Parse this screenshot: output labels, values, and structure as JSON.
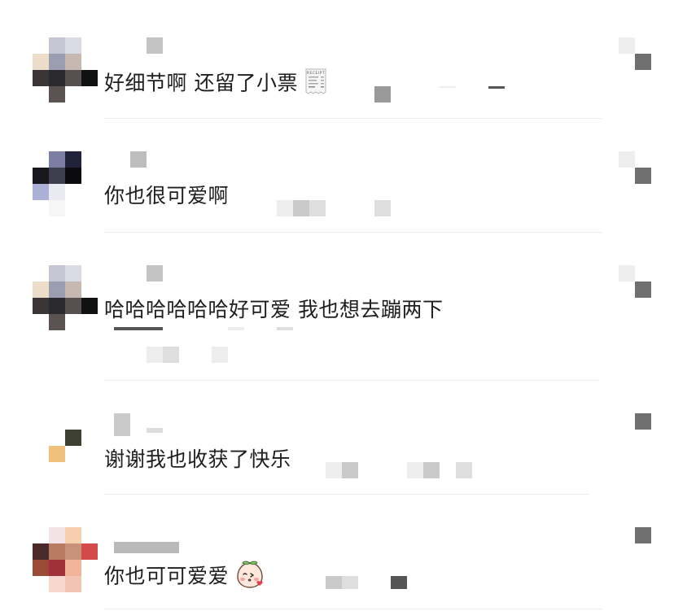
{
  "comments": [
    {
      "text": "好细节啊 还留了小票",
      "emoji": "receipt-emoji"
    },
    {
      "text": "你也很可爱啊",
      "emoji": ""
    },
    {
      "text": "哈哈哈哈哈哈好可爱 我也想去蹦两下",
      "emoji": ""
    },
    {
      "text": "谢谢我也收获了快乐",
      "emoji": ""
    },
    {
      "text": "你也可可爱爱",
      "emoji": "peach-kiss-emoji"
    }
  ],
  "receipt_label": "RECEIPT",
  "colors": {
    "background": "#ffffff",
    "text": "#1e1e1e",
    "divider": "#ececec",
    "mosaic_dark": "#6f6f6f",
    "mosaic_light": "#eeeeee"
  }
}
